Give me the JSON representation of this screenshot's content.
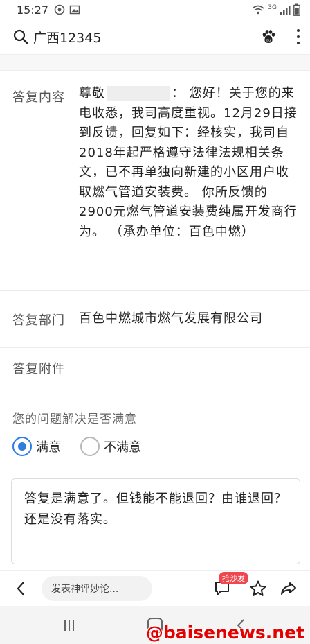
{
  "status_bar": {
    "time": "15:27",
    "network": "3G"
  },
  "header": {
    "query": "广西12345",
    "search_icon": "search-icon",
    "paw_icon": "baidu-paw-icon",
    "more_icon": "more-vertical-icon"
  },
  "reply": {
    "content_label": "答复内容",
    "content_prefix": "尊敬",
    "content_text": "：  您好！关于您的来电收悉，我司高度重视。12月29日接到反馈，回复如下：经核实，我司自2018年起严格遵守法律法规相关条文，已不再单独向新建的小区用户收取燃气管道安装费。  你所反馈的2900元燃气管道安装费纯属开发商行为。 （承办单位：百色中燃）",
    "department_label": "答复部门",
    "department_value": "百色中燃城市燃气发展有限公司",
    "attachment_label": "答复附件"
  },
  "satisfaction": {
    "question": "您的问题解决是否满意",
    "options": [
      {
        "label": "满意",
        "selected": true
      },
      {
        "label": "不满意",
        "selected": false
      }
    ]
  },
  "comment": {
    "text": "答复是满意了。但钱能不能退回？由谁退回？还是没有落实。"
  },
  "toolbar": {
    "input_placeholder": "发表神评妙论...",
    "badge": "抢沙发"
  },
  "watermark": "@baisenews.net",
  "colors": {
    "accent": "#2f7de1",
    "badge": "#f0474f",
    "watermark": "#e30000"
  }
}
